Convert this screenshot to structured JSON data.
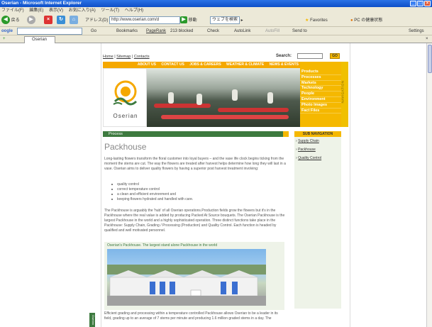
{
  "window": {
    "title": "Oserian - Microsoft Internet Explorer",
    "min_label": "_",
    "max_label": "□",
    "close_label": "×"
  },
  "menubar": {
    "items": [
      "ファイル(F)",
      "編集(E)",
      "表示(V)",
      "お気に入り(A)",
      "ツール(T)",
      "ヘルプ(H)"
    ]
  },
  "toolbar": {
    "back_label": "戻る",
    "address_label": "アドレス(D)",
    "address_value": "http://www.oserian.com/d",
    "go_label": "移動",
    "search_placeholder": "ウェブを検索",
    "favorites_label": "Favorites",
    "health_label": "PC の健康状態"
  },
  "google_bar": {
    "logo": "oogle",
    "go_label": "Go",
    "bookmarks_label": "Bookmarks",
    "pagerank_label": "PageRank",
    "blocked_label": "213 blocked",
    "check_label": "Check",
    "autolink_label": "AutoLink",
    "autofill_label": "AutoFill",
    "sendto_label": "Send to",
    "settings_label": "Settings"
  },
  "tabs": {
    "active": "Oserian"
  },
  "page": {
    "toplinks": [
      "Home",
      "Sitemap",
      "Contacts"
    ],
    "search_label": "Search:",
    "go_button": "GO",
    "nav": [
      "ABOUT US",
      "CONTACT US",
      "JOBS & CAREERS",
      "WEATHER & CLIMATE",
      "NEWS & EVENTS"
    ],
    "logo_text": "Oserian",
    "right_menu": [
      "Products",
      "Processes",
      "Markets",
      "Technology",
      "People",
      "Environment",
      "Photo Images",
      "Fact Files"
    ],
    "vertical_nav": "NAVIGATION",
    "section": "Process",
    "title": "Packhouse",
    "intro": "Long-lasting flowers transform the floral customer into loyal buyers – and the vase life clock begins ticking from the moment the stems are cut. The way the flowers are treated after harvest helps determine how long they will last in a vase. Oserian aims to deliver quality flowers by having a superior post harvest treatment involving:",
    "bullets": [
      "quality control",
      "correct temperature control",
      "a clean and efficient environment and",
      "keeping flowers hydrated and handled with care."
    ],
    "body": "The Packhouse is arguably the 'hub' of all Oserian operations.Production fields grow the flowers but it's in the Packhouse where the real value is added by producing Packed At Source bouquets. The Oserian Packhouse is the largest Packhouse in the world and a highly sophisticated operation. Three distinct functions take place in the Packhouse: Supply Chain, Grading / Processing (Production) and Quality Control. Each function is headed by qualified and well motivated personnel.",
    "caption": "Oserian's Packhouse. The largest stand alone Packhouse in the world",
    "footer_para": "Efficient grading and processing within a temperature controlled Packhouse allows Oserian to be a leader in its field, grading up to an average of 7 stems per minute and producing 1.6 million graded stems in a day. The",
    "side_tab": "Oserian",
    "subnav_head": "SUB NAVIGATION",
    "subnav": [
      "Supply Chain",
      "Packhouse",
      "Quality Control"
    ]
  }
}
